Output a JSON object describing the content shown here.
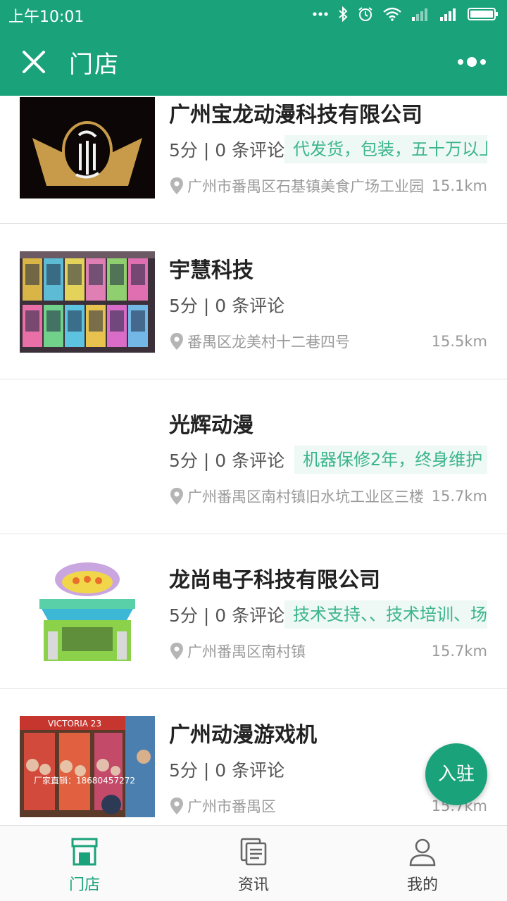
{
  "status_bar": {
    "time": "上午10:01"
  },
  "header": {
    "title": "门店"
  },
  "stores": [
    {
      "name": "广州宝龙动漫科技有限公司",
      "rating": "5分 | 0 条评论",
      "tag": "代发货，包装，五十万以上",
      "address": "广州市番禺区石基镇美食广场工业园",
      "distance": "15.1km"
    },
    {
      "name": "宇慧科技",
      "rating": "5分 | 0 条评论",
      "tag": "",
      "address": "番禺区龙美村十二巷四号",
      "distance": "15.5km"
    },
    {
      "name": "光辉动漫",
      "rating": "5分 | 0 条评论",
      "tag": "机器保修2年，终身维护",
      "address": "广州番禺区南村镇旧水坑工业区三楼",
      "distance": "15.7km"
    },
    {
      "name": "龙尚电子科技有限公司",
      "rating": "5分 | 0 条评论",
      "tag": "技术支持、、技术培训、场地规划",
      "address": "广州番禺区南村镇",
      "distance": "15.7km"
    },
    {
      "name": "广州动漫游戏机",
      "rating": "5分 | 0 条评论",
      "tag": "",
      "address": "广州市番禺区",
      "distance": "15.7km",
      "photo_caption": "厂家直销：18680457272",
      "photo_sign": "VICTORIA 23"
    }
  ],
  "fab": {
    "label": "入驻"
  },
  "tabbar": {
    "items": [
      {
        "label": "门店",
        "icon": "store-icon",
        "active": true
      },
      {
        "label": "资讯",
        "icon": "news-icon",
        "active": false
      },
      {
        "label": "我的",
        "icon": "user-icon",
        "active": false
      }
    ]
  },
  "colors": {
    "primary": "#1aa37a",
    "tag_bg": "#eef8f4",
    "tag_text": "#3cb58d"
  }
}
